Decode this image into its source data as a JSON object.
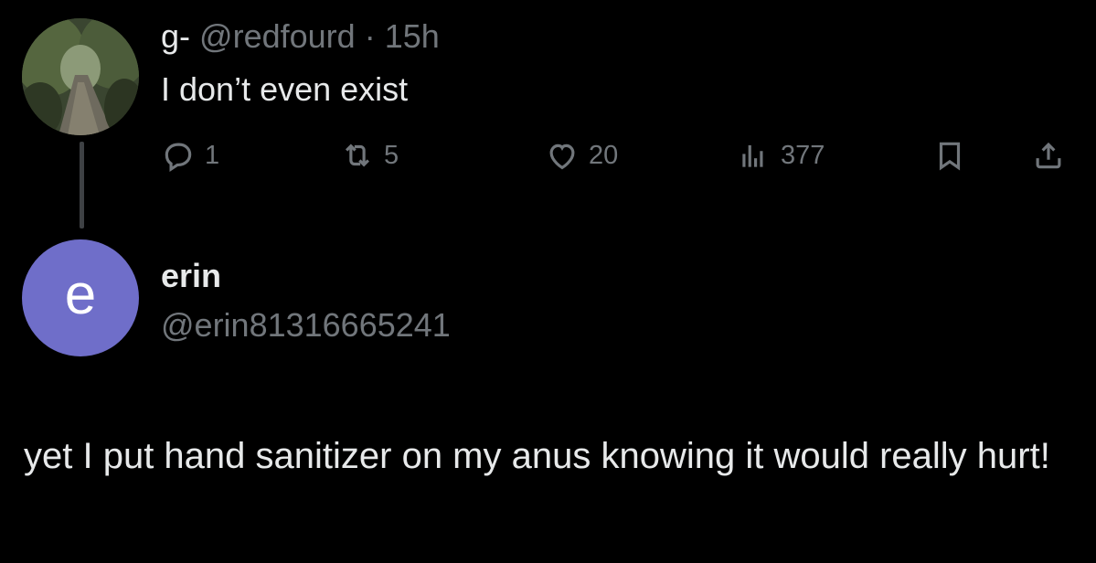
{
  "parent_tweet": {
    "display_name": "g-",
    "handle": "@redfourd",
    "separator": "·",
    "time": "15h",
    "text": "I don’t even exist",
    "actions": {
      "replies": "1",
      "retweets": "5",
      "likes": "20",
      "views": "377"
    }
  },
  "reply_tweet": {
    "avatar_letter": "e",
    "avatar_color": "#6f6ec9",
    "display_name": "erin",
    "handle": "@erin81316665241",
    "text": "yet I put hand sanitizer on my anus knowing it would really hurt!"
  },
  "icons": [
    "reply-icon",
    "retweet-icon",
    "like-icon",
    "views-icon",
    "bookmark-icon",
    "share-icon"
  ],
  "colors": {
    "background": "#000000",
    "primary_text": "#e7e9ea",
    "secondary_text": "#71767b",
    "thread_line": "#3e4144"
  }
}
